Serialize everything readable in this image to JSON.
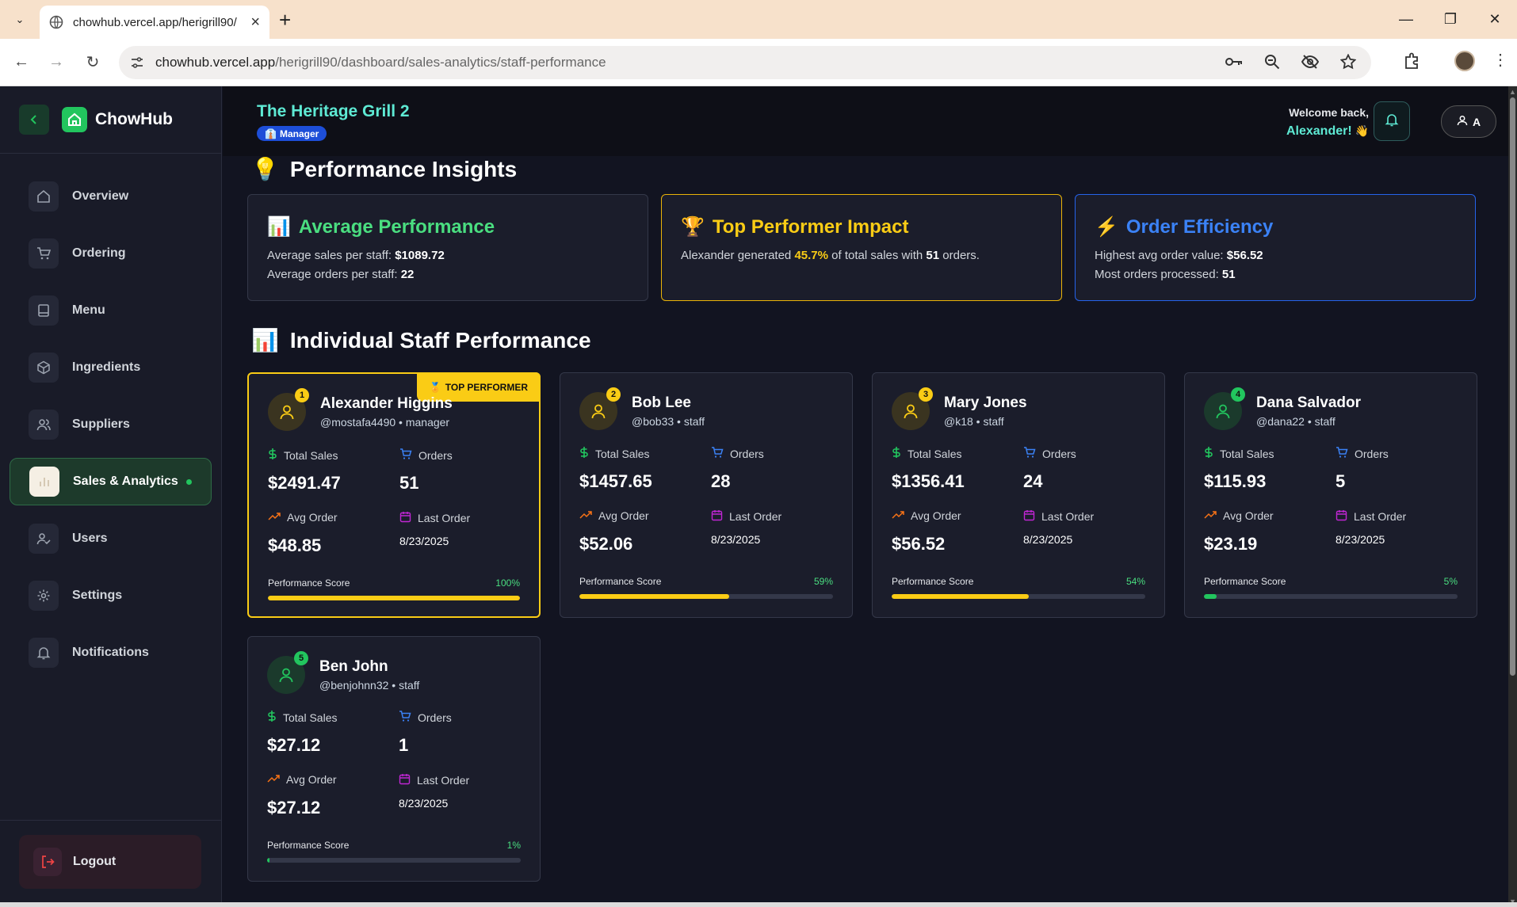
{
  "browser": {
    "tab_title": "chowhub.vercel.app/herigrill90/",
    "url_host": "chowhub.vercel.app",
    "url_path": "/herigrill90/dashboard/sales-analytics/staff-performance"
  },
  "sidebar": {
    "brand": "ChowHub",
    "items": [
      {
        "label": "Overview",
        "icon": "home-icon"
      },
      {
        "label": "Ordering",
        "icon": "cart-icon"
      },
      {
        "label": "Menu",
        "icon": "book-icon"
      },
      {
        "label": "Ingredients",
        "icon": "box-icon"
      },
      {
        "label": "Suppliers",
        "icon": "users-icon"
      },
      {
        "label": "Sales & Analytics",
        "icon": "bar-chart-icon",
        "active": true
      },
      {
        "label": "Users",
        "icon": "user-check-icon"
      },
      {
        "label": "Settings",
        "icon": "gear-icon"
      },
      {
        "label": "Notifications",
        "icon": "bell-icon"
      }
    ],
    "logout": "Logout"
  },
  "header": {
    "restaurant": "The Heritage Grill 2",
    "role": "Manager",
    "welcome": "Welcome back,",
    "user_name": "Alexander!",
    "wave": "👋",
    "user_initial": "A"
  },
  "insights": {
    "title": "Performance Insights",
    "title_emoji": "💡",
    "average": {
      "emoji": "📊",
      "title": "Average Performance",
      "line1_label": "Average sales per staff:",
      "line1_value": "$1089.72",
      "line2_label": "Average orders per staff:",
      "line2_value": "22"
    },
    "top": {
      "emoji": "🏆",
      "title": "Top Performer Impact",
      "text_a": "Alexander generated",
      "pct": "45.7%",
      "text_b": "of total sales with",
      "orders": "51",
      "text_c": "orders."
    },
    "efficiency": {
      "emoji": "⚡",
      "title": "Order Efficiency",
      "line1_label": "Highest avg order value:",
      "line1_value": "$56.52",
      "line2_label": "Most orders processed:",
      "line2_value": "51"
    }
  },
  "staff_section": {
    "title": "Individual Staff Performance",
    "title_emoji": "📊",
    "top_badge": "TOP PERFORMER",
    "top_badge_emoji": "🏅",
    "labels": {
      "total_sales": "Total Sales",
      "orders": "Orders",
      "avg_order": "Avg Order",
      "last_order": "Last Order",
      "score": "Performance Score"
    },
    "staff": [
      {
        "rank": "1",
        "name": "Alexander Higgins",
        "sub": "@mostafa4490 • manager",
        "sales": "$2491.47",
        "orders": "51",
        "avg": "$48.85",
        "last": "8/23/2025",
        "score_label": "100%",
        "score": 1.0
      },
      {
        "rank": "2",
        "name": "Bob Lee",
        "sub": "@bob33 • staff",
        "sales": "$1457.65",
        "orders": "28",
        "avg": "$52.06",
        "last": "8/23/2025",
        "score_label": "59%",
        "score": 0.59
      },
      {
        "rank": "3",
        "name": "Mary Jones",
        "sub": "@k18 • staff",
        "sales": "$1356.41",
        "orders": "24",
        "avg": "$56.52",
        "last": "8/23/2025",
        "score_label": "54%",
        "score": 0.54
      },
      {
        "rank": "4",
        "name": "Dana Salvador",
        "sub": "@dana22 • staff",
        "sales": "$115.93",
        "orders": "5",
        "avg": "$23.19",
        "last": "8/23/2025",
        "score_label": "5%",
        "score": 0.05
      },
      {
        "rank": "5",
        "name": "Ben John",
        "sub": "@benjohnn32 • staff",
        "sales": "$27.12",
        "orders": "1",
        "avg": "$27.12",
        "last": "8/23/2025",
        "score_label": "1%",
        "score": 0.01
      }
    ]
  },
  "colors": {
    "accent": "#22c55e",
    "gold": "#facc15",
    "teal": "#5eead4",
    "blue": "#2563eb"
  }
}
